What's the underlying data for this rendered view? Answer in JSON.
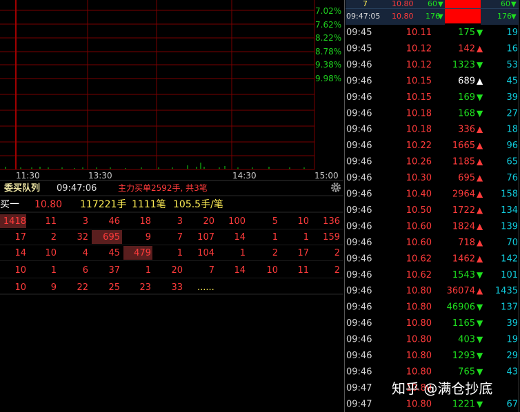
{
  "chart": {
    "pct_labels": [
      "7.02%",
      "7.62%",
      "8.22%",
      "8.78%",
      "9.38%",
      "9.98%"
    ],
    "time_labels": [
      "11:30",
      "13:30",
      "14:30",
      "15:00"
    ],
    "colors": {
      "grid": "#7a0000",
      "up": "#ff3b3b",
      "down": "#1fe01f",
      "flat": "#ffffff"
    }
  },
  "queue": {
    "title": "委买队列",
    "time": "09:47:06",
    "summary_note": "主力买单2592手, 共3笔",
    "settings_icon": "gear-icon",
    "level_label": "买一",
    "price": "10.80",
    "volume": "117221手",
    "orders": "1111笔",
    "avg": "105.5手/笔",
    "rows": [
      [
        "1418",
        "11",
        "3",
        "46",
        "18",
        "3",
        "20",
        "100",
        "5",
        "10",
        "136"
      ],
      [
        "17",
        "2",
        "32",
        "695",
        "9",
        "7",
        "107",
        "14",
        "1",
        "1",
        "159"
      ],
      [
        "14",
        "10",
        "4",
        "45",
        "479",
        "1",
        "104",
        "1",
        "2",
        "17",
        "2"
      ],
      [
        "10",
        "1",
        "6",
        "37",
        "1",
        "20",
        "7",
        "14",
        "10",
        "11",
        "2"
      ],
      [
        "10",
        "9",
        "22",
        "25",
        "23",
        "33",
        "......"
      ]
    ]
  },
  "top_panel": {
    "row1": {
      "time": "",
      "price": "10.80",
      "vol": "60",
      "count": "7",
      "right_vol": "60"
    },
    "row2": {
      "time": "09:47:05",
      "price": "10.80",
      "vol": "176",
      "right_vol": "176"
    }
  },
  "ticks": [
    {
      "time": "09:45",
      "price": "10.11",
      "vol": "175",
      "dir": "down",
      "count": "19"
    },
    {
      "time": "09:45",
      "price": "10.12",
      "vol": "142",
      "dir": "up",
      "count": "16"
    },
    {
      "time": "09:46",
      "price": "10.12",
      "vol": "1323",
      "dir": "down",
      "count": "53"
    },
    {
      "time": "09:46",
      "price": "10.15",
      "vol": "689",
      "dir": "flat",
      "count": "45"
    },
    {
      "time": "09:46",
      "price": "10.15",
      "vol": "169",
      "dir": "down",
      "count": "39"
    },
    {
      "time": "09:46",
      "price": "10.18",
      "vol": "168",
      "dir": "down",
      "count": "27"
    },
    {
      "time": "09:46",
      "price": "10.18",
      "vol": "336",
      "dir": "up",
      "count": "18"
    },
    {
      "time": "09:46",
      "price": "10.22",
      "vol": "1665",
      "dir": "up",
      "count": "96"
    },
    {
      "time": "09:46",
      "price": "10.26",
      "vol": "1185",
      "dir": "up",
      "count": "65"
    },
    {
      "time": "09:46",
      "price": "10.30",
      "vol": "695",
      "dir": "up",
      "count": "76"
    },
    {
      "time": "09:46",
      "price": "10.40",
      "vol": "2964",
      "dir": "up",
      "count": "158"
    },
    {
      "time": "09:46",
      "price": "10.50",
      "vol": "1722",
      "dir": "up",
      "count": "134"
    },
    {
      "time": "09:46",
      "price": "10.60",
      "vol": "1824",
      "dir": "up",
      "count": "139"
    },
    {
      "time": "09:46",
      "price": "10.60",
      "vol": "718",
      "dir": "up",
      "count": "70"
    },
    {
      "time": "09:46",
      "price": "10.62",
      "vol": "1462",
      "dir": "up",
      "count": "142"
    },
    {
      "time": "09:46",
      "price": "10.62",
      "vol": "1543",
      "dir": "down",
      "count": "101"
    },
    {
      "time": "09:46",
      "price": "10.80",
      "vol": "36074",
      "dir": "up",
      "count": "1435"
    },
    {
      "time": "09:46",
      "price": "10.80",
      "vol": "46906",
      "dir": "down",
      "count": "137"
    },
    {
      "time": "09:46",
      "price": "10.80",
      "vol": "1165",
      "dir": "down",
      "count": "39"
    },
    {
      "time": "09:46",
      "price": "10.80",
      "vol": "403",
      "dir": "down",
      "count": "19"
    },
    {
      "time": "09:46",
      "price": "10.80",
      "vol": "1293",
      "dir": "down",
      "count": "29"
    },
    {
      "time": "09:46",
      "price": "10.80",
      "vol": "765",
      "dir": "down",
      "count": "43"
    },
    {
      "time": "09:47",
      "price": "10.80",
      "vol": "",
      "dir": "down",
      "count": ""
    },
    {
      "time": "09:47",
      "price": "10.80",
      "vol": "1221",
      "dir": "down",
      "count": "67"
    }
  ],
  "watermark": "知乎 @满仓抄底"
}
